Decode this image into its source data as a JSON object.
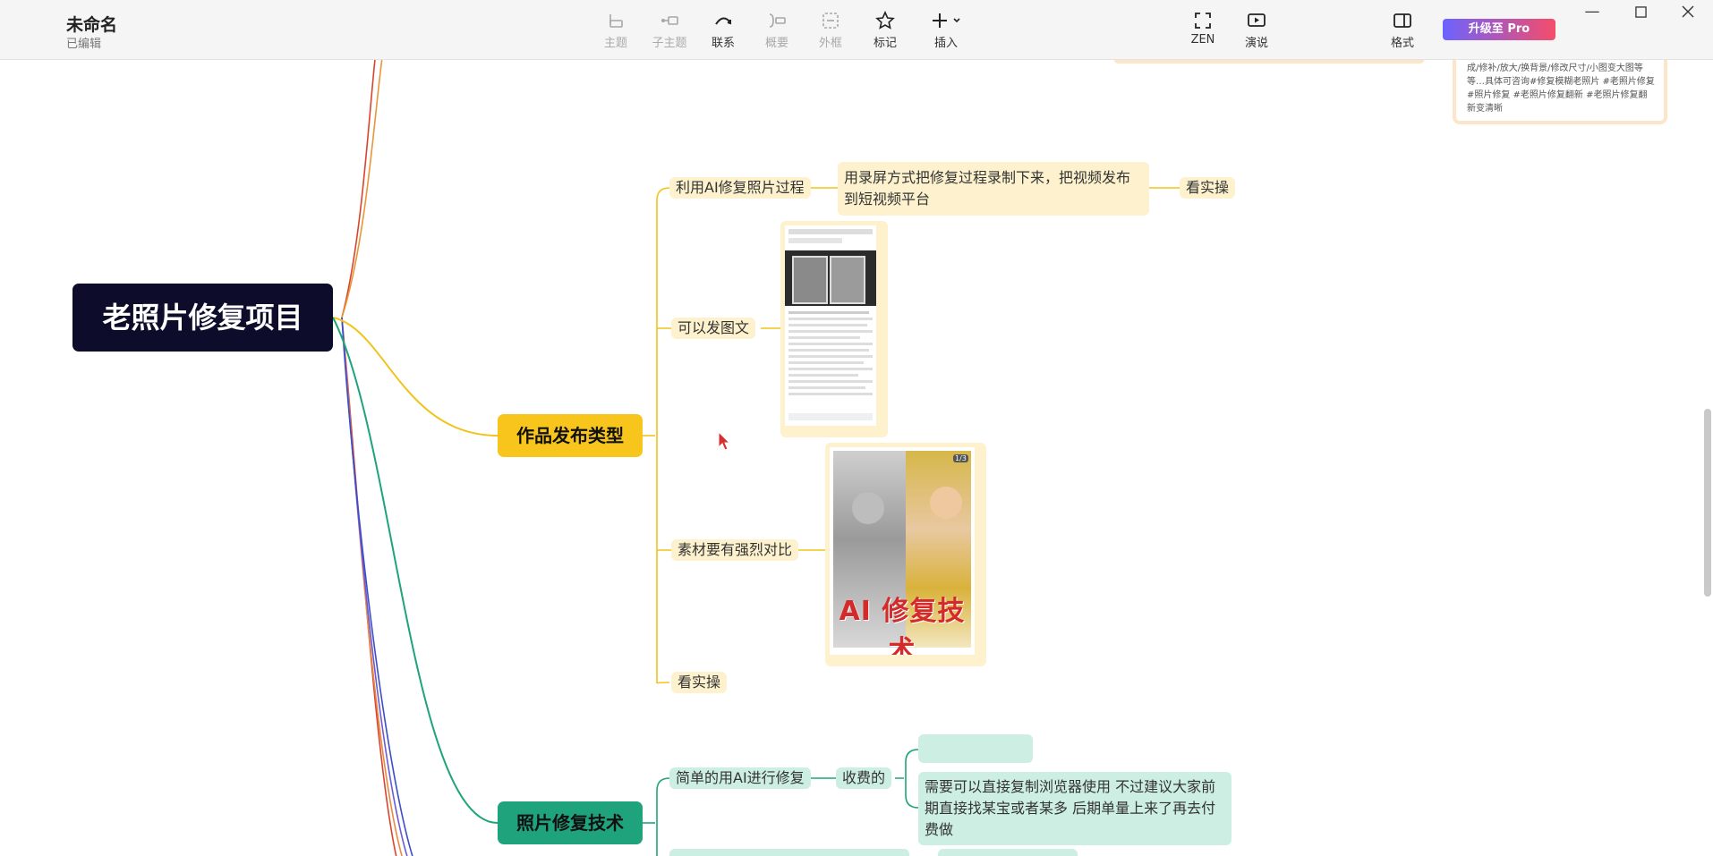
{
  "app": {
    "doc_title": "未命名",
    "doc_status": "已编辑",
    "upgrade_label": "升级至 Pro"
  },
  "toolbar": {
    "topic": "主题",
    "subtopic": "子主题",
    "relation": "联系",
    "summary": "概要",
    "boundary": "外框",
    "marker": "标记",
    "insert": "插入",
    "zen": "ZEN",
    "present": "演说",
    "format": "格式"
  },
  "mindmap": {
    "root": "老照片修复项目",
    "branch1": {
      "label": "作品发布类型",
      "color": "#f7c51b",
      "children": {
        "c1": "利用AI修复照片过程",
        "c1_detail": "用录屏方式把修复过程录制下来，把视频发布到短视频平台",
        "c1_action": "看实操",
        "c2": "可以发图文",
        "c3": "素材要有强烈对比",
        "c3_image_caption": "AI 修复技术",
        "c3_image_counter": "1/3",
        "c4": "看实操"
      }
    },
    "branch2": {
      "label": "照片修复技术",
      "color": "#1fa37d",
      "children": {
        "c1": "简单的用AI进行修复",
        "c1_type": "收费的",
        "c1_note": "需要可以直接复制浏览器使用 不过建议大家前期直接找某宝或者某多  后期单量上来了再去付费做"
      }
    },
    "corner_card_text": "成/修补/放大/换背景/修改尺寸/小图变大图等等…具体可咨询#修复模糊老照片 #老照片修复 #照片修复 #老照片修复翻新 #老照片修复翻新变清晰"
  },
  "colors": {
    "toolbar_bg": "#f5f5f5",
    "root_bg": "#0d0d2b",
    "yellow_node": "#fdf2cd",
    "green_node": "#cdeee2"
  }
}
